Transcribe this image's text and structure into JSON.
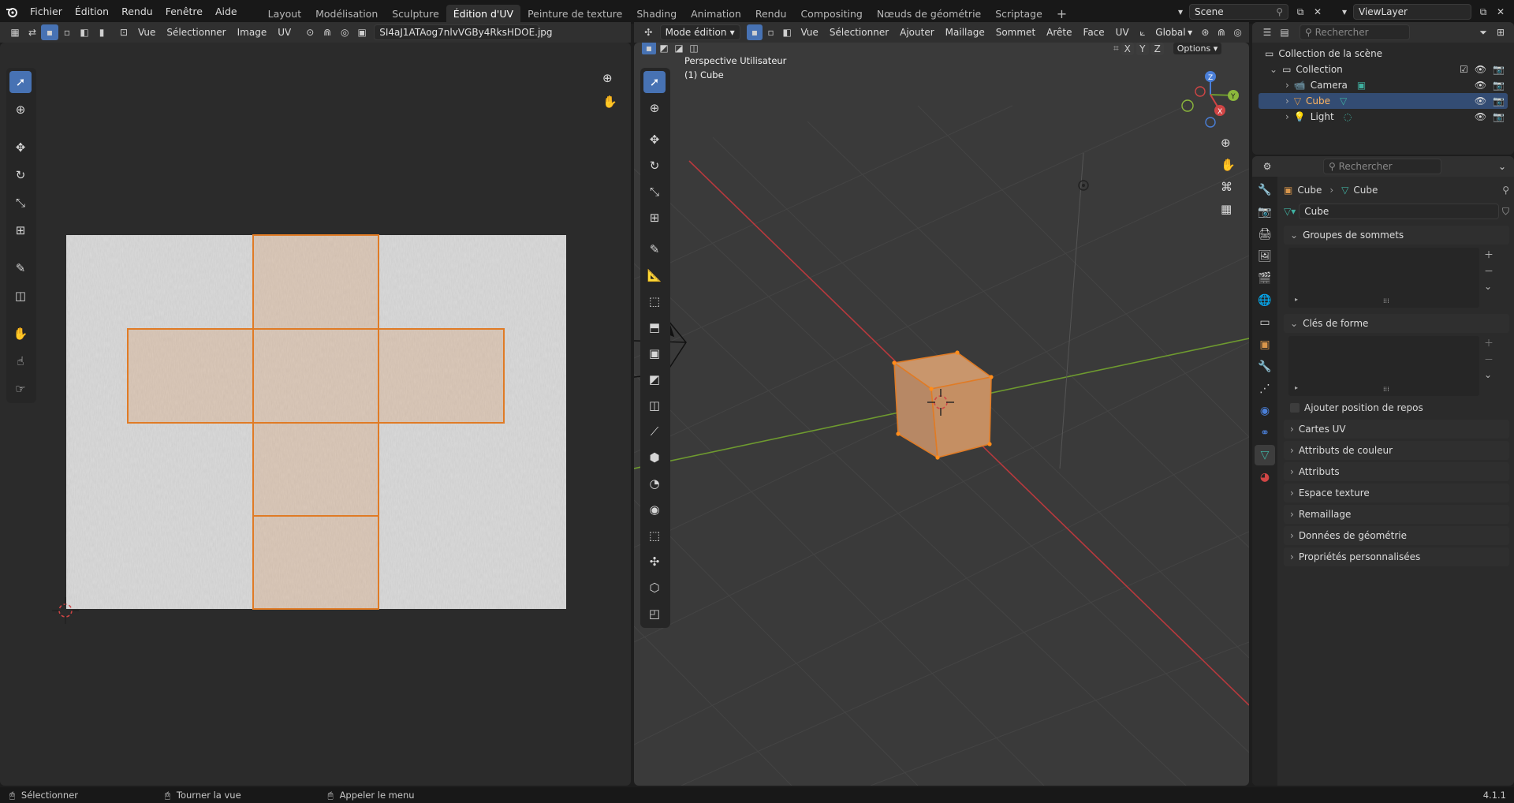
{
  "topbar": {
    "menus": [
      "Fichier",
      "Édition",
      "Rendu",
      "Fenêtre",
      "Aide"
    ],
    "workspaces": [
      "Layout",
      "Modélisation",
      "Sculpture",
      "Édition d'UV",
      "Peinture de texture",
      "Shading",
      "Animation",
      "Rendu",
      "Compositing",
      "Nœuds de géométrie",
      "Scriptage"
    ],
    "active_workspace": "Édition d'UV",
    "add_tab": "+",
    "scene": "Scene",
    "view_layer": "ViewLayer"
  },
  "uv_editor": {
    "menus": [
      "Vue",
      "Sélectionner",
      "Image",
      "UV"
    ],
    "image_name": "SI4aJ1ATAog7nlvVGBy4RksHDOE.jpg"
  },
  "viewport": {
    "mode": "Mode édition",
    "menus": [
      "Vue",
      "Sélectionner",
      "Ajouter",
      "Maillage",
      "Sommet",
      "Arête",
      "Face",
      "UV"
    ],
    "orientation": "Global",
    "options_label": "Options",
    "axis_x": "X",
    "axis_y": "Y",
    "axis_z": "Z",
    "overlay_line1": "Perspective Utilisateur",
    "overlay_line2": "(1) Cube",
    "gizmo": {
      "x": "X",
      "y": "Y",
      "z": "Z"
    }
  },
  "outliner": {
    "search_placeholder": "Rechercher",
    "root": "Collection de la scène",
    "collection": "Collection",
    "items": [
      {
        "name": "Camera",
        "icon": "camera-icon",
        "selected": false
      },
      {
        "name": "Cube",
        "icon": "mesh-icon",
        "selected": true
      },
      {
        "name": "Light",
        "icon": "light-icon",
        "selected": false
      }
    ]
  },
  "properties": {
    "search_placeholder": "Rechercher",
    "breadcrumb_object": "Cube",
    "breadcrumb_data": "Cube",
    "mesh_name": "Cube",
    "sections": {
      "vertex_groups": "Groupes de sommets",
      "shape_keys": "Clés de forme",
      "rest_position": "Ajouter position de repos"
    },
    "collapsed": [
      "Cartes UV",
      "Attributs de couleur",
      "Attributs",
      "Espace texture",
      "Remaillage",
      "Données de géométrie",
      "Propriétés personnalisées"
    ]
  },
  "statusbar": {
    "select": "Sélectionner",
    "rotate": "Tourner la vue",
    "menu": "Appeler le menu",
    "version": "4.1.1"
  },
  "colors": {
    "accent": "#4772b3",
    "uv_edge": "#e07b25",
    "mesh_face": "#c9966c",
    "axis_red": "#b8393d",
    "axis_green": "#6e9a2f"
  }
}
